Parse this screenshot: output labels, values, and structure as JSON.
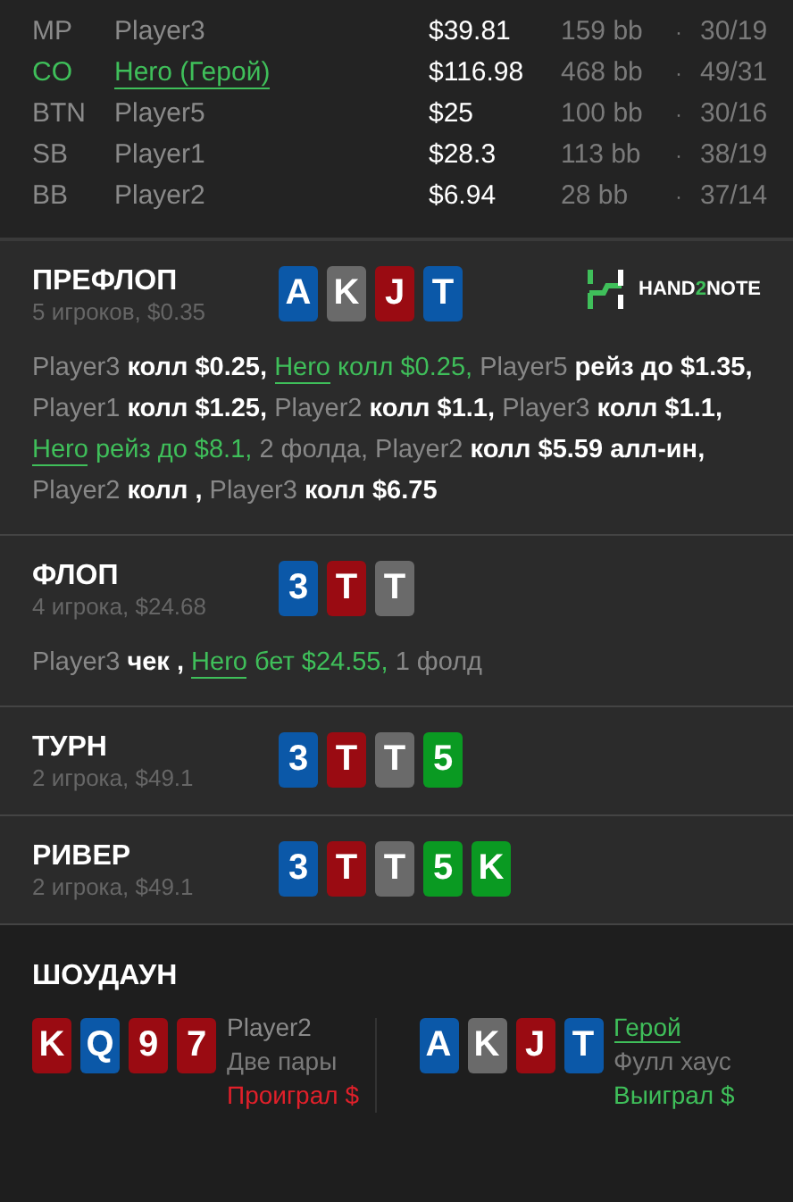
{
  "players": [
    {
      "position": "MP",
      "name": "Player3",
      "hero": false,
      "stack": "$39.81",
      "bb": "159 bb",
      "separator": "·",
      "stats": "30/19"
    },
    {
      "position": "CO",
      "name": "Hero (Герой)",
      "hero": true,
      "stack": "$116.98",
      "bb": "468 bb",
      "separator": "·",
      "stats": "49/31"
    },
    {
      "position": "BTN",
      "name": "Player5",
      "hero": false,
      "stack": "$25",
      "bb": "100 bb",
      "separator": "·",
      "stats": "30/16"
    },
    {
      "position": "SB",
      "name": "Player1",
      "hero": false,
      "stack": "$28.3",
      "bb": "113 bb",
      "separator": "·",
      "stats": "38/19"
    },
    {
      "position": "BB",
      "name": "Player2",
      "hero": false,
      "stack": "$6.94",
      "bb": "28 bb",
      "separator": "·",
      "stats": "37/14"
    }
  ],
  "streets": [
    {
      "title": "ПРЕФЛОП",
      "info": "5 игроков, $0.35",
      "logo": {
        "parts": [
          "HAND",
          "2",
          "NOTE"
        ]
      },
      "cards": [
        {
          "rank": "A",
          "color": "#0b58a8"
        },
        {
          "rank": "K",
          "color": "#6a6a6a"
        },
        {
          "rank": "J",
          "color": "#9a0b12"
        },
        {
          "rank": "T",
          "color": "#0b58a8"
        }
      ],
      "actions": [
        {
          "kind": "player",
          "text": "Player3"
        },
        {
          "kind": "action",
          "text": "колл $0.25,"
        },
        {
          "kind": "hero",
          "text": "Hero"
        },
        {
          "kind": "hero-action",
          "text": "колл $0.25,"
        },
        {
          "kind": "player",
          "text": "Player5"
        },
        {
          "kind": "action",
          "text": "рейз до $1.35,"
        },
        {
          "kind": "player",
          "text": "Player1"
        },
        {
          "kind": "action",
          "text": "колл $1.25,"
        },
        {
          "kind": "player",
          "text": "Player2"
        },
        {
          "kind": "action",
          "text": "колл $1.1,"
        },
        {
          "kind": "player",
          "text": "Player3"
        },
        {
          "kind": "action",
          "text": "колл $1.1,"
        },
        {
          "kind": "hero",
          "text": "Hero"
        },
        {
          "kind": "hero-action",
          "text": "рейз до $8.1,"
        },
        {
          "kind": "player",
          "text": "2 фолда,"
        },
        {
          "kind": "player",
          "text": "Player2"
        },
        {
          "kind": "action",
          "text": "колл $5.59 алл-ин,"
        },
        {
          "kind": "player",
          "text": "Player2"
        },
        {
          "kind": "action",
          "text": "колл ,"
        },
        {
          "kind": "player",
          "text": "Player3"
        },
        {
          "kind": "action",
          "text": "колл $6.75"
        }
      ]
    },
    {
      "title": "ФЛОП",
      "info": "4 игрока, $24.68",
      "cards": [
        {
          "rank": "3",
          "color": "#0b58a8"
        },
        {
          "rank": "T",
          "color": "#9a0b12"
        },
        {
          "rank": "T",
          "color": "#6a6a6a"
        }
      ],
      "actions": [
        {
          "kind": "player",
          "text": "Player3"
        },
        {
          "kind": "action",
          "text": "чек ,"
        },
        {
          "kind": "hero",
          "text": "Hero"
        },
        {
          "kind": "hero-action",
          "text": "бет $24.55,"
        },
        {
          "kind": "player",
          "text": "1 фолд"
        }
      ]
    },
    {
      "title": "ТУРН",
      "info": "2 игрока, $49.1",
      "cards": [
        {
          "rank": "3",
          "color": "#0b58a8"
        },
        {
          "rank": "T",
          "color": "#9a0b12"
        },
        {
          "rank": "T",
          "color": "#6a6a6a"
        },
        {
          "rank": "5",
          "color": "#0a9a22"
        }
      ]
    },
    {
      "title": "РИВЕР",
      "info": "2 игрока, $49.1",
      "cards": [
        {
          "rank": "3",
          "color": "#0b58a8"
        },
        {
          "rank": "T",
          "color": "#9a0b12"
        },
        {
          "rank": "T",
          "color": "#6a6a6a"
        },
        {
          "rank": "5",
          "color": "#0a9a22"
        },
        {
          "rank": "K",
          "color": "#0a9a22"
        }
      ]
    }
  ],
  "showdown": {
    "title": "ШОУДАУН",
    "hands": [
      {
        "name": "Player2",
        "hero": false,
        "won": false,
        "combo": "Две пары",
        "result": "Проиграл $",
        "cards": [
          {
            "rank": "K",
            "color": "#9a0b12"
          },
          {
            "rank": "Q",
            "color": "#0b58a8"
          },
          {
            "rank": "9",
            "color": "#9a0b12"
          },
          {
            "rank": "7",
            "color": "#9a0b12"
          }
        ]
      },
      {
        "name": "Герой",
        "hero": true,
        "won": true,
        "combo": "Фулл хаус",
        "result": "Выиграл $",
        "cards": [
          {
            "rank": "A",
            "color": "#0b58a8"
          },
          {
            "rank": "K",
            "color": "#6a6a6a"
          },
          {
            "rank": "J",
            "color": "#9a0b12"
          },
          {
            "rank": "T",
            "color": "#0b58a8"
          }
        ]
      }
    ]
  }
}
